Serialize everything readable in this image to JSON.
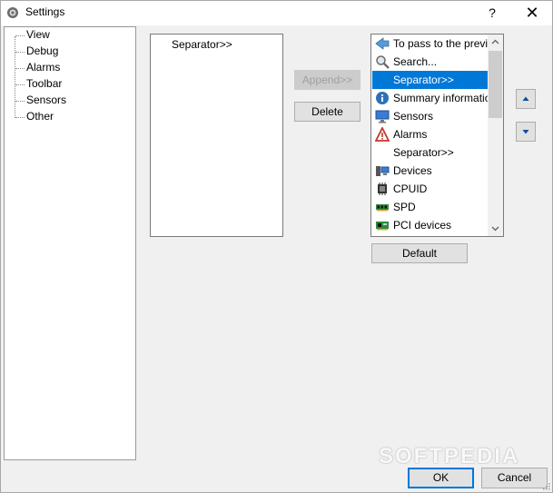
{
  "window": {
    "title": "Settings",
    "help_symbol": "?",
    "close_symbol": "✕"
  },
  "tree": {
    "items": [
      "View",
      "Debug",
      "Alarms",
      "Toolbar",
      "Sensors",
      "Other"
    ]
  },
  "selected_list": {
    "items": [
      "Separator>>"
    ]
  },
  "buttons": {
    "append": "Append>>",
    "delete": "Delete",
    "default": "Default",
    "ok": "OK",
    "cancel": "Cancel"
  },
  "available_list": {
    "items": [
      {
        "label": "To pass to the previous",
        "icon": "back-arrow-icon"
      },
      {
        "label": "Search...",
        "icon": "magnifier-icon"
      },
      {
        "label": "Separator>>",
        "icon": "",
        "selected": true
      },
      {
        "label": "Summary information",
        "icon": "info-icon"
      },
      {
        "label": "Sensors",
        "icon": "monitor-icon"
      },
      {
        "label": "Alarms",
        "icon": "warning-icon"
      },
      {
        "label": "Separator>>",
        "icon": ""
      },
      {
        "label": "Devices",
        "icon": "devices-icon"
      },
      {
        "label": "CPUID",
        "icon": "chip-icon"
      },
      {
        "label": "SPD",
        "icon": "memory-icon"
      },
      {
        "label": "PCI devices",
        "icon": "pci-card-icon"
      }
    ]
  },
  "watermark": "SOFTPEDIA",
  "colors": {
    "selection": "#0078d7",
    "arrow": "#0050a0"
  }
}
